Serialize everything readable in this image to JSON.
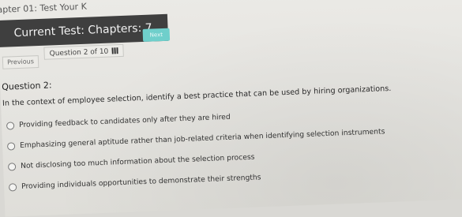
{
  "header": {
    "tab_title": "apter 01: Test Your K",
    "test_title": "Current Test: Chapters: 7"
  },
  "navigation": {
    "previous_label": "Previous",
    "question_indicator": "Question 2 of 10",
    "question_grid_icon": "grid-icon",
    "next_label": "Next"
  },
  "question": {
    "label": "Question 2:",
    "text": "In the context of employee selection, identify a best practice that can be used by hiring organizations.",
    "options": [
      "Providing feedback to candidates only after they are hired",
      "Emphasizing general aptitude rather than job-related criteria when identifying selection instruments",
      "Not disclosing too much information about the selection process",
      "Providing individuals opportunities to demonstrate their strengths"
    ]
  },
  "colors": {
    "header_bg": "#3f3f3f",
    "next_button": "#6fcfcb",
    "page_bg": "#e6e5e1"
  }
}
